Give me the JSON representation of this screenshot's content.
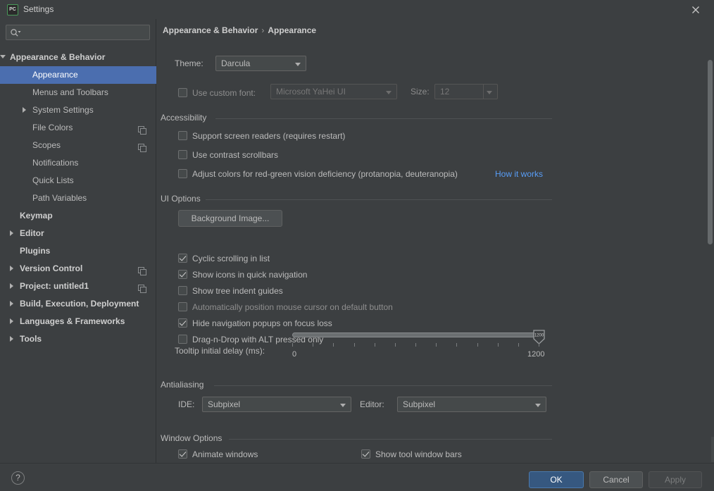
{
  "window": {
    "title": "Settings",
    "app_icon": "pycharm-icon",
    "app_icon_text": "PC",
    "close_icon": "close-icon"
  },
  "sidebar": {
    "search": {
      "placeholder": "",
      "value": "",
      "icon": "search-icon"
    },
    "items": [
      {
        "label": "Appearance & Behavior",
        "indent": 14,
        "arrow": "down",
        "bold": true,
        "selected": false,
        "icon": null
      },
      {
        "label": "Appearance",
        "indent": 46,
        "arrow": null,
        "bold": false,
        "selected": true,
        "icon": null
      },
      {
        "label": "Menus and Toolbars",
        "indent": 46,
        "arrow": null,
        "bold": false,
        "selected": false,
        "icon": null
      },
      {
        "label": "System Settings",
        "indent": 46,
        "arrow": "right",
        "bold": false,
        "selected": false,
        "icon": null
      },
      {
        "label": "File Colors",
        "indent": 46,
        "arrow": null,
        "bold": false,
        "selected": false,
        "icon": "copy-scope-icon"
      },
      {
        "label": "Scopes",
        "indent": 46,
        "arrow": null,
        "bold": false,
        "selected": false,
        "icon": "copy-scope-icon"
      },
      {
        "label": "Notifications",
        "indent": 46,
        "arrow": null,
        "bold": false,
        "selected": false,
        "icon": null
      },
      {
        "label": "Quick Lists",
        "indent": 46,
        "arrow": null,
        "bold": false,
        "selected": false,
        "icon": null
      },
      {
        "label": "Path Variables",
        "indent": 46,
        "arrow": null,
        "bold": false,
        "selected": false,
        "icon": null
      },
      {
        "label": "Keymap",
        "indent": 28,
        "arrow": null,
        "bold": true,
        "selected": false,
        "icon": null
      },
      {
        "label": "Editor",
        "indent": 28,
        "arrow": "right",
        "bold": true,
        "selected": false,
        "icon": null
      },
      {
        "label": "Plugins",
        "indent": 28,
        "arrow": null,
        "bold": true,
        "selected": false,
        "icon": null
      },
      {
        "label": "Version Control",
        "indent": 28,
        "arrow": "right",
        "bold": true,
        "selected": false,
        "icon": "copy-scope-icon"
      },
      {
        "label": "Project: untitled1",
        "indent": 28,
        "arrow": "right",
        "bold": true,
        "selected": false,
        "icon": "copy-scope-icon"
      },
      {
        "label": "Build, Execution, Deployment",
        "indent": 28,
        "arrow": "right",
        "bold": true,
        "selected": false,
        "icon": null
      },
      {
        "label": "Languages & Frameworks",
        "indent": 28,
        "arrow": "right",
        "bold": true,
        "selected": false,
        "icon": null
      },
      {
        "label": "Tools",
        "indent": 28,
        "arrow": "right",
        "bold": true,
        "selected": false,
        "icon": null
      }
    ]
  },
  "main": {
    "breadcrumb": {
      "root": "Appearance & Behavior",
      "separator": "›",
      "current": "Appearance"
    },
    "theme": {
      "label": "Theme:",
      "value": "Darcula"
    },
    "custom_font": {
      "checkbox_label": "Use custom font:",
      "checked": false,
      "font_value": "Microsoft YaHei UI",
      "size_label": "Size:",
      "size_value": "12",
      "disabled": true
    },
    "accessibility": {
      "title": "Accessibility",
      "items": [
        {
          "label": "Support screen readers (requires restart)",
          "checked": false
        },
        {
          "label": "Use contrast scrollbars",
          "checked": false
        },
        {
          "label": "Adjust colors for red-green vision deficiency (protanopia, deuteranopia)",
          "checked": false
        }
      ],
      "link": "How it works"
    },
    "ui_options": {
      "title": "UI Options",
      "background_image_button": "Background Image...",
      "items": [
        {
          "label": "Cyclic scrolling in list",
          "checked": true,
          "dim": false
        },
        {
          "label": "Show icons in quick navigation",
          "checked": true,
          "dim": false
        },
        {
          "label": "Show tree indent guides",
          "checked": false,
          "dim": false
        },
        {
          "label": "Automatically position mouse cursor on default button",
          "checked": false,
          "dim": true
        },
        {
          "label": "Hide navigation popups on focus loss",
          "checked": true,
          "dim": false
        },
        {
          "label": "Drag-n-Drop with ALT pressed only",
          "checked": false,
          "dim": false
        }
      ],
      "tooltip_slider": {
        "label": "Tooltip initial delay (ms):",
        "min_label": "0",
        "max_label": "1200",
        "min": 0,
        "max": 1200,
        "value": 1200,
        "thumb_value": "1200",
        "tick_count": 13
      }
    },
    "antialiasing": {
      "title": "Antialiasing",
      "ide_label": "IDE:",
      "ide_value": "Subpixel",
      "editor_label": "Editor:",
      "editor_value": "Subpixel"
    },
    "window_options": {
      "title": "Window Options",
      "items": [
        {
          "label": "Animate windows",
          "checked": true
        },
        {
          "label": "Show tool window bars",
          "checked": true
        }
      ]
    }
  },
  "footer": {
    "help_label": "?",
    "ok_label": "OK",
    "cancel_label": "Cancel",
    "apply_label": "Apply"
  },
  "colors": {
    "background": "#3c3f41",
    "selection": "#4b6eaf",
    "primary_button": "#365880",
    "link": "#589df6",
    "text": "#bbbbbb"
  }
}
